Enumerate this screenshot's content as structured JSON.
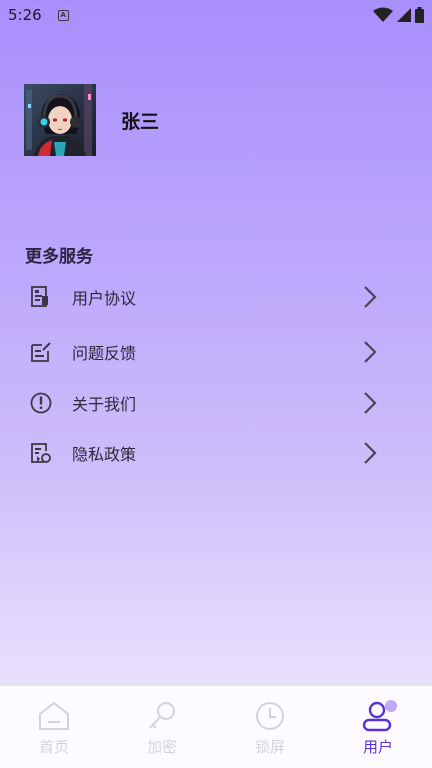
{
  "status_bar": {
    "time": "5:26",
    "notification_icon": "a-icon",
    "wifi_icon": "wifi-icon",
    "signal_icon": "signal-icon",
    "battery_icon": "battery-icon"
  },
  "profile": {
    "avatar_icon": "avatar-image",
    "name": "张三"
  },
  "services": {
    "title": "更多服务",
    "items": [
      {
        "label": "用户协议",
        "icon": "agreement-icon"
      },
      {
        "label": "问题反馈",
        "icon": "feedback-icon"
      },
      {
        "label": "关于我们",
        "icon": "info-icon"
      },
      {
        "label": "隐私政策",
        "icon": "privacy-icon"
      }
    ]
  },
  "bottom_nav": {
    "items": [
      {
        "label": "首页",
        "icon": "home-icon",
        "active": false
      },
      {
        "label": "加密",
        "icon": "key-icon",
        "active": false
      },
      {
        "label": "锁屏",
        "icon": "clock-icon",
        "active": false
      },
      {
        "label": "用户",
        "icon": "user-icon",
        "active": true
      }
    ]
  },
  "colors": {
    "accent": "#5a31d6",
    "inactive": "#d5d3da",
    "gradient_top": "#a88ffd",
    "gradient_bottom": "#efe8fd"
  }
}
